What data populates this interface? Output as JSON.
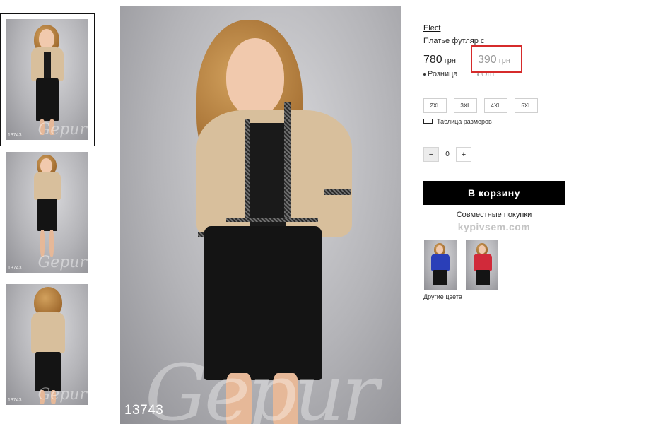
{
  "thumbnails": [
    {
      "code": "13743",
      "watermark": "Gepur"
    },
    {
      "code": "13743",
      "watermark": "Gepur"
    },
    {
      "code": "13743",
      "watermark": "Gepur"
    }
  ],
  "main_photo": {
    "code": "13743",
    "watermark": "Gepur"
  },
  "product": {
    "brand": "Elect",
    "title": "Платье футляр с",
    "retail_price": "780",
    "retail_currency": "грн",
    "retail_label": "Розница",
    "opt_price": "390",
    "opt_currency": "грн",
    "opt_label": "Опт"
  },
  "sizes": [
    "2XL",
    "3XL",
    "4XL",
    "5XL"
  ],
  "size_table_label": "Таблица размеров",
  "quantity": {
    "minus": "−",
    "value": "0",
    "plus": "+"
  },
  "cart_button": "В корзину",
  "joint_purchase": {
    "label": "Совместные покупки",
    "site": "kypivsem.com"
  },
  "other_colors_label": "Другие цвета",
  "colors": {
    "highlight": "#d62b2b",
    "button": "#000000"
  }
}
